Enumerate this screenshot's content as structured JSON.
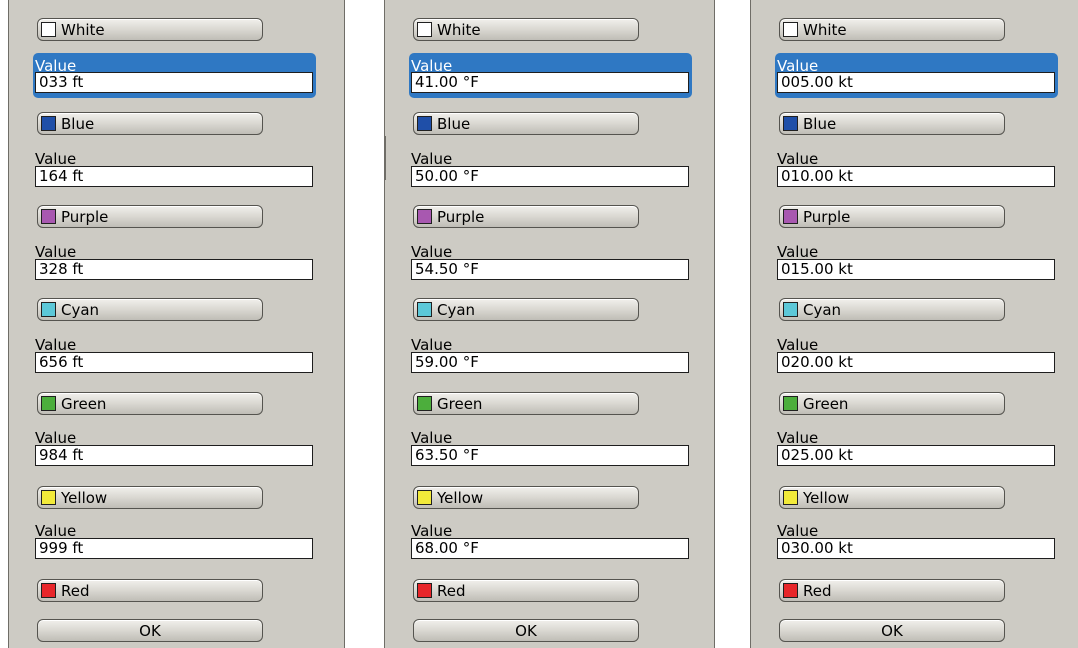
{
  "colors": {
    "white": {
      "label": "White",
      "hex": "#ffffff"
    },
    "blue": {
      "label": "Blue",
      "hex": "#1f4fa8"
    },
    "purple": {
      "label": "Purple",
      "hex": "#a858b0"
    },
    "cyan": {
      "label": "Cyan",
      "hex": "#5cc8d8"
    },
    "green": {
      "label": "Green",
      "hex": "#4cae3c"
    },
    "yellow": {
      "label": "Yellow",
      "hex": "#f2ea3a"
    },
    "red": {
      "label": "Red",
      "hex": "#e8262a"
    }
  },
  "value_label": "Value",
  "ok_label": "OK",
  "highlight_color": "#2f78c3",
  "panels": [
    {
      "values": [
        "033 ft",
        "164 ft",
        "328 ft",
        "656 ft",
        "984 ft",
        "999 ft"
      ]
    },
    {
      "values": [
        "41.00 °F",
        "50.00 °F",
        "54.50 °F",
        "59.00 °F",
        "63.50 °F",
        "68.00 °F"
      ]
    },
    {
      "values": [
        "005.00 kt",
        "010.00 kt",
        "015.00 kt",
        "020.00 kt",
        "025.00 kt",
        "030.00 kt"
      ]
    }
  ]
}
